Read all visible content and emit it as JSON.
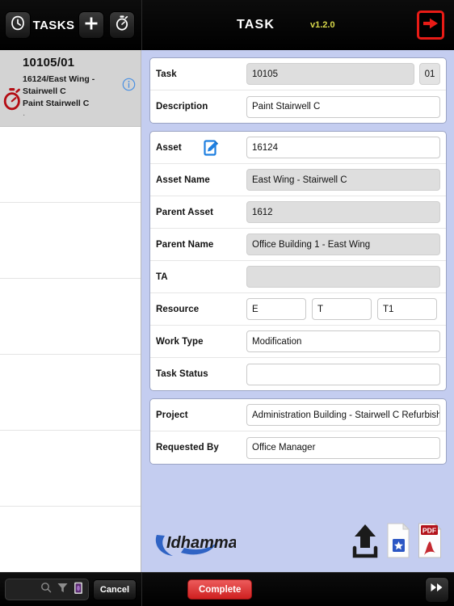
{
  "header": {
    "tasks_label": "TASKS",
    "title": "TASK",
    "version": "v1.2.0",
    "history_icon": "clock-history-icon",
    "add_icon": "plus-icon",
    "timer_icon": "stopwatch-icon",
    "exit_icon": "exit-arrow-icon"
  },
  "sidebar": {
    "selected_task": {
      "id": "10105/01",
      "asset": "16124/East Wing - Stairwell C",
      "description": "Paint Stairwell C",
      "extra": "·",
      "timer_icon": "stopwatch-icon",
      "info_icon": "info-circle-icon"
    },
    "empty_rows": 6
  },
  "form": {
    "groups": [
      {
        "name": "task-group",
        "fields": [
          {
            "label": "Task",
            "value": "10105",
            "readonly": true,
            "suffix": "01"
          },
          {
            "label": "Description",
            "value": "Paint Stairwell C",
            "readonly": false
          }
        ]
      },
      {
        "name": "asset-group",
        "fields": [
          {
            "label": "Asset",
            "value": "16124",
            "readonly": false,
            "icon": "edit-document-icon"
          },
          {
            "label": "Asset Name",
            "value": "East Wing - Stairwell C",
            "readonly": true
          },
          {
            "label": "Parent Asset",
            "value": "1612",
            "readonly": true
          },
          {
            "label": "Parent Name",
            "value": "Office Building 1 - East Wing",
            "readonly": true
          },
          {
            "label": "TA",
            "value": "",
            "readonly": true
          },
          {
            "label": "Resource",
            "multi": [
              "E",
              "T",
              "T1"
            ],
            "readonly": false
          },
          {
            "label": "Work Type",
            "value": "Modification",
            "readonly": false
          },
          {
            "label": "Task Status",
            "value": "",
            "readonly": false
          }
        ]
      },
      {
        "name": "project-group",
        "fields": [
          {
            "label": "Project",
            "value": "Administration Building - Stairwell C Refurbishment",
            "readonly": false
          },
          {
            "label": "Requested By",
            "value": "Office Manager",
            "readonly": false
          }
        ]
      }
    ]
  },
  "footer": {
    "logo_text": "Idhammar",
    "upload_icon": "upload-arrow-icon",
    "document_icon": "document-star-icon",
    "pdf_icon": "pdf-file-icon",
    "pdf_label": "PDF"
  },
  "bottombar": {
    "search_placeholder": "",
    "search_icon": "search-icon",
    "filter_icon": "funnel-filter-icon",
    "clipboard_icon": "clipboard-icon",
    "cancel_label": "Cancel",
    "complete_label": "Complete",
    "next_icon": "fast-forward-icon"
  },
  "colors": {
    "accent_blue": "#c4cdf0",
    "complete_red": "#d62828",
    "exit_red": "#e81b16",
    "version_yellow": "#d8d84a",
    "icon_blue": "#1e7fe0"
  }
}
